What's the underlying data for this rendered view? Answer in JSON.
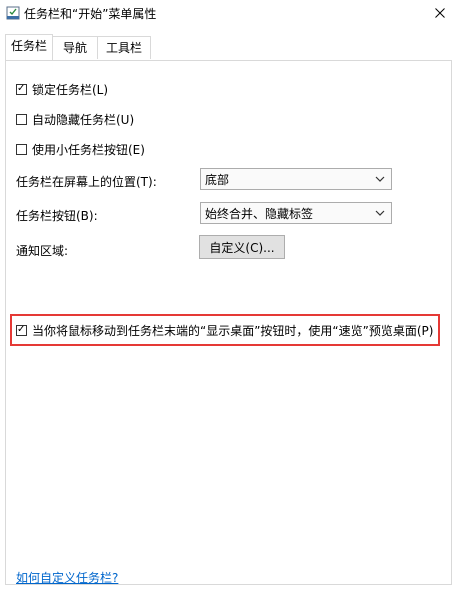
{
  "window": {
    "title": "任务栏和“开始”菜单属性"
  },
  "tabs": [
    {
      "label": "任务栏",
      "active": true
    },
    {
      "label": "导航",
      "active": false
    },
    {
      "label": "工具栏",
      "active": false
    }
  ],
  "options": {
    "lock_taskbar": {
      "label": "锁定任务栏(L)",
      "checked": true
    },
    "auto_hide": {
      "label": "自动隐藏任务栏(U)",
      "checked": false
    },
    "small_buttons": {
      "label": "使用小任务栏按钮(E)",
      "checked": false
    }
  },
  "location": {
    "label": "任务栏在屏幕上的位置(T):",
    "value": "底部"
  },
  "buttons_combine": {
    "label": "任务栏按钮(B):",
    "value": "始终合并、隐藏标签"
  },
  "notification": {
    "label": "通知区域:",
    "button_label": "自定义(C)..."
  },
  "peek": {
    "label": "当你将鼠标移动到任务栏末端的“显示桌面”按钮时，使用“速览”预览桌面(P)",
    "checked": true,
    "highlight_color": "#e53935"
  },
  "help_link": {
    "label": "如何自定义任务栏?"
  }
}
